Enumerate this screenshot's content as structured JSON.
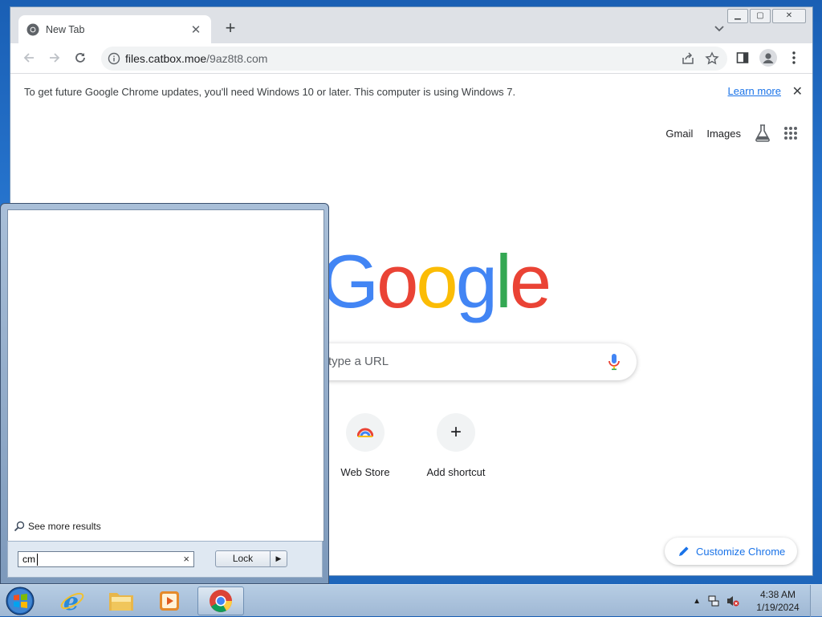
{
  "tab": {
    "title": "New Tab"
  },
  "omnibox": {
    "domain": "files.catbox.moe",
    "path": "/9az8t8.com"
  },
  "infobar": {
    "message": "To get future Google Chrome updates, you'll need Windows 10 or later. This computer is using Windows 7.",
    "learn_more": "Learn more"
  },
  "ntp": {
    "links": {
      "gmail": "Gmail",
      "images": "Images"
    },
    "logo": [
      "G",
      "o",
      "o",
      "g",
      "l",
      "e"
    ],
    "logo_colors": [
      "#4285F4",
      "#EA4335",
      "#FBBC05",
      "#4285F4",
      "#34A853",
      "#EA4335"
    ],
    "search_placeholder": "type a URL",
    "shortcuts": [
      {
        "label": "Web Store"
      },
      {
        "label": "Add shortcut",
        "glyph": "+"
      }
    ],
    "customize_label": "Customize Chrome"
  },
  "start_menu": {
    "see_more": "See more results",
    "search_value": "cm",
    "clear_glyph": "×",
    "lock_label": "Lock",
    "lock_arrow": "▶"
  },
  "taskbar": {
    "items": [
      "internet-explorer",
      "windows-explorer",
      "media-player",
      "google-chrome"
    ],
    "time": "4:38 AM",
    "date": "1/19/2024"
  },
  "colors": {
    "accent": "#1a73e8",
    "tab_strip": "#dee1e6",
    "taskbar": "#b7cde4"
  }
}
